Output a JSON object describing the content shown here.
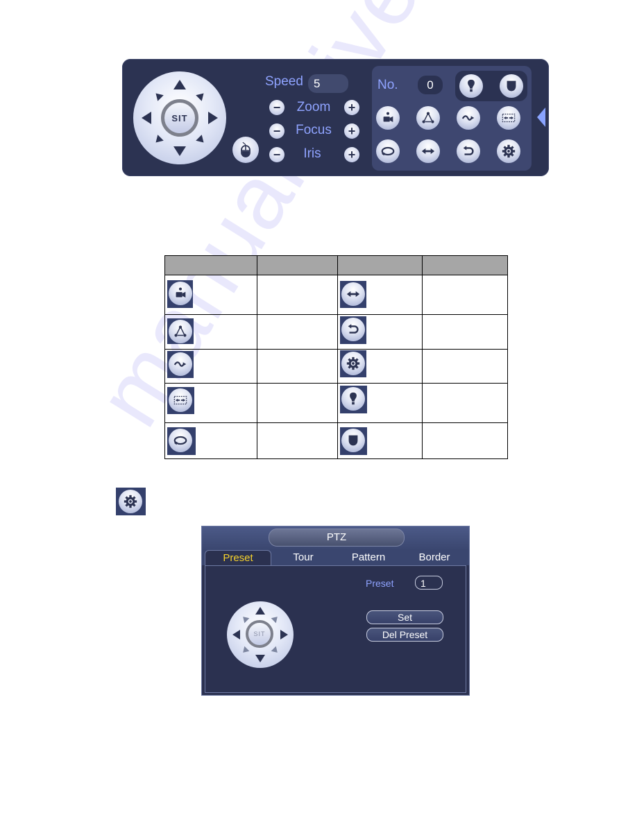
{
  "watermark": "manualshive.com",
  "ptz_bar": {
    "dpad_center_label": "SIT",
    "speed_label": "Speed",
    "speed_value": "5",
    "rows": [
      {
        "label": "Zoom",
        "minus": "−",
        "plus": "+"
      },
      {
        "label": "Focus",
        "minus": "−",
        "plus": "+"
      },
      {
        "label": "Iris",
        "minus": "−",
        "plus": "+"
      }
    ],
    "no_label": "No.",
    "no_value": "0",
    "icons_row1": [
      "light-icon",
      "wiper-icon"
    ],
    "icons_row2": [
      "preset-icon",
      "tour-icon",
      "pattern-icon",
      "scan-icon"
    ],
    "icons_row3": [
      "rotate-icon",
      "pan-icon",
      "flip-icon",
      "settings-icon"
    ]
  },
  "icon_table": {
    "headers": [
      "",
      "",
      "",
      ""
    ],
    "rows": [
      {
        "left_icon": "preset-icon",
        "left_text": "",
        "right_icon": "pan-icon",
        "right_text": ""
      },
      {
        "left_icon": "tour-icon",
        "left_text": "",
        "right_icon": "flip-icon",
        "right_text": ""
      },
      {
        "left_icon": "pattern-icon",
        "left_text": "",
        "right_icon": "settings-icon",
        "right_text": ""
      },
      {
        "left_icon": "scan-icon",
        "left_text": "",
        "right_icon": "light-icon",
        "right_text": ""
      },
      {
        "left_icon": "rotate-icon",
        "left_text": "",
        "right_icon": "wiper-icon",
        "right_text": ""
      }
    ]
  },
  "standalone_icon": "settings-icon",
  "ptz_dialog": {
    "title": "PTZ",
    "tabs": [
      {
        "label": "Preset",
        "active": true
      },
      {
        "label": "Tour",
        "active": false
      },
      {
        "label": "Pattern",
        "active": false
      },
      {
        "label": "Border",
        "active": false
      }
    ],
    "preset_label": "Preset",
    "preset_value": "1",
    "set_button": "Set",
    "del_preset_button": "Del Preset",
    "dpad_center_label": "SIT"
  },
  "colors": {
    "panel_bg": "#2c3352",
    "label_blue": "#8fa3ff",
    "active_tab": "#f6d22c",
    "table_header": "#a6a6a6"
  }
}
